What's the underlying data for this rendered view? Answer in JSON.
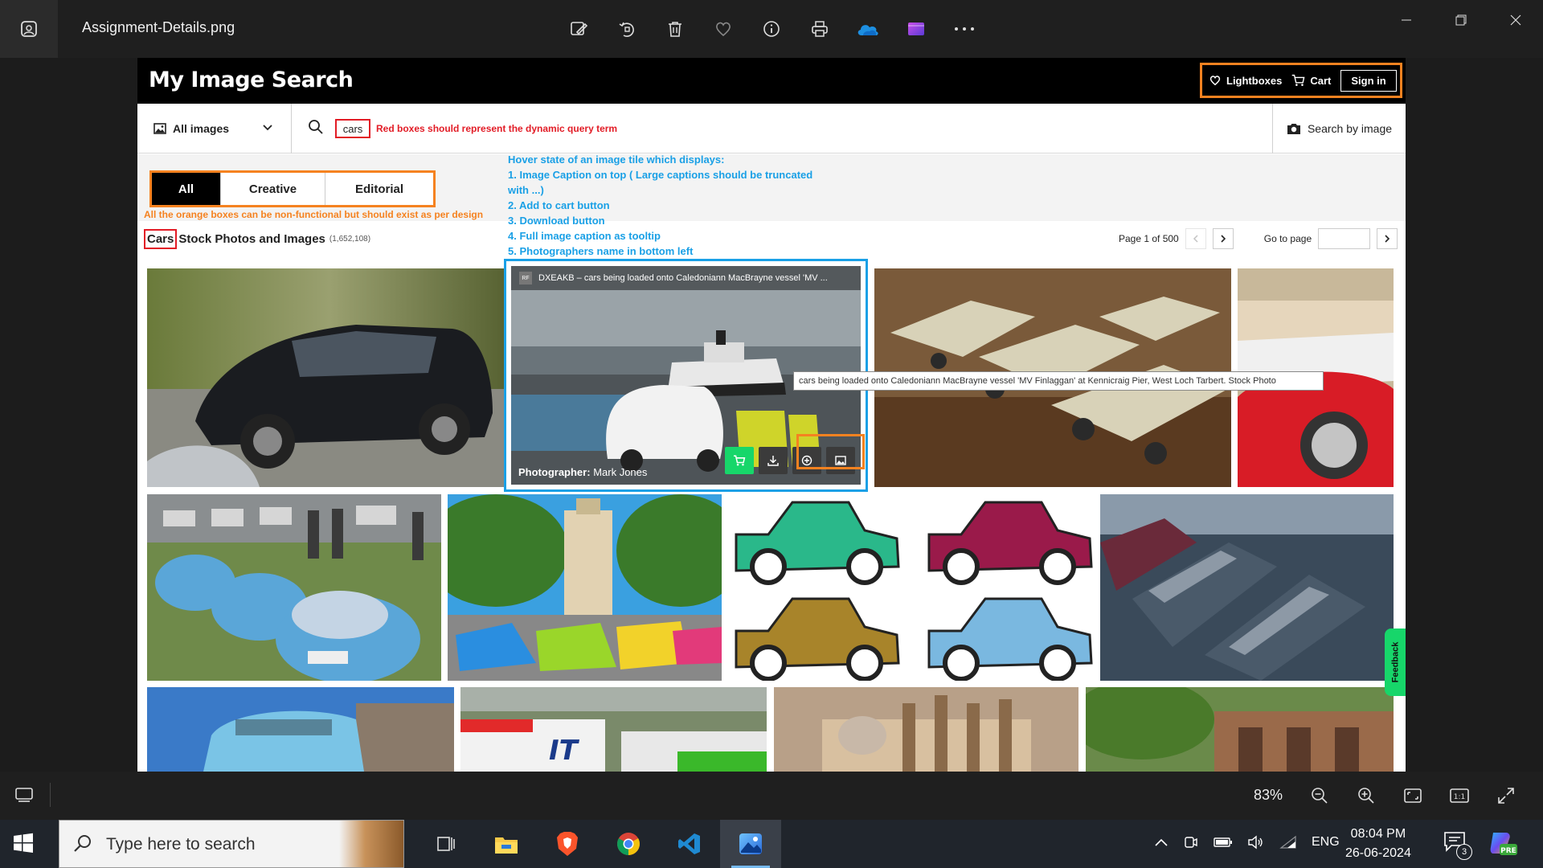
{
  "titlebar": {
    "file_name": "Assignment-Details.png",
    "tools": [
      "edit-icon",
      "rotate-icon",
      "delete-icon",
      "favorite-icon",
      "info-icon",
      "print-icon",
      "onedrive-icon",
      "clipchamp-icon",
      "more-icon"
    ]
  },
  "site": {
    "logo": "My Image Search",
    "lightboxes": "Lightboxes",
    "cart": "Cart",
    "signin": "Sign in"
  },
  "search": {
    "scope": "All images",
    "query": "cars",
    "note": "Red boxes should represent the dynamic query term",
    "search_by_image": "Search by image"
  },
  "tabs": [
    {
      "label": "All",
      "active": true
    },
    {
      "label": "Creative",
      "active": false
    },
    {
      "label": "Editorial",
      "active": false
    }
  ],
  "notes": {
    "orange": "All the orange boxes can be non-functional but should exist as per design",
    "hover_lines": [
      "Hover state of an image tile which displays:",
      "1. Image Caption on top ( Large captions should be truncated",
      "with ...)",
      "2. Add to cart button",
      "3. Download button",
      "4. Full image caption as tooltip",
      "5. Photographers name in bottom left"
    ]
  },
  "results": {
    "term": "Cars",
    "title_rest": "Stock Photos and Images",
    "count": "(1,652,108)"
  },
  "pager": {
    "page_text": "Page 1 of 500",
    "goto_label": "Go to page"
  },
  "hover_tile": {
    "badge": "RF",
    "caption": "DXEAKB – cars being loaded onto Caledoniann MacBrayne vessel 'MV ...",
    "caption_id": "DXEAKB",
    "photographer_label": "Photographer:",
    "photographer": "Mark Jones",
    "tooltip": "cars being loaded onto Caledoniann MacBrayne vessel 'MV Finlaggan' at Kennicraig Pier, West Loch Tarbert. Stock Photo"
  },
  "feedback": "Feedback",
  "statusbar": {
    "zoom": "83%"
  },
  "taskbar": {
    "search_placeholder": "Type here to search",
    "lang": "ENG",
    "time": "08:04 PM",
    "date": "26-06-2024",
    "notifications": "3"
  },
  "colors": {
    "accent_orange": "#f58220",
    "query_red": "#e21c26",
    "note_blue": "#1aa0e6",
    "cart_green": "#17d66a"
  }
}
